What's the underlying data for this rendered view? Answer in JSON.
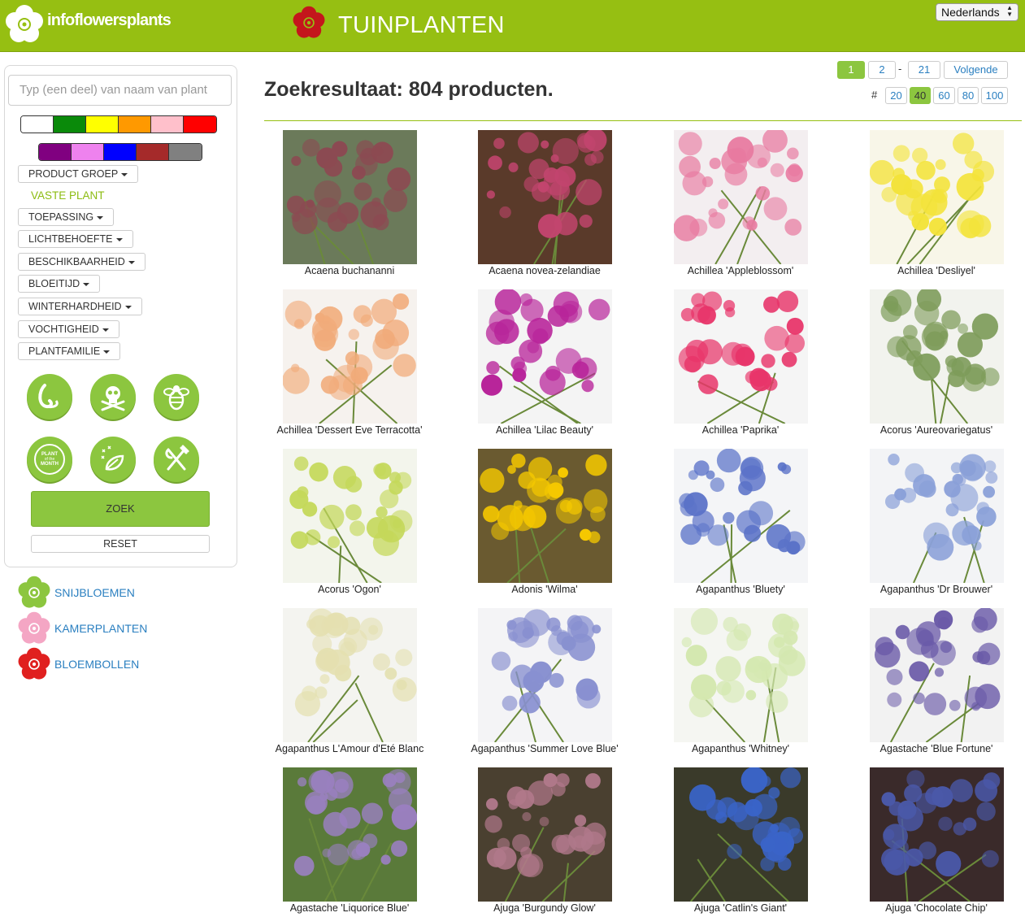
{
  "header": {
    "logo_text": "infoflowersplants",
    "section_title": "TUINPLANTEN",
    "language": "Nederlands"
  },
  "sidebar": {
    "search_placeholder": "Typ (een deel) van naam van plant",
    "color_swatches_row1": [
      "#ffffff",
      "#0a8a0a",
      "#ffff00",
      "#ff9900",
      "#ffc0cb",
      "#ff0000"
    ],
    "color_swatches_row2": [
      "#800080",
      "#ee82ee",
      "#0000ff",
      "#a52a2a",
      "#808080"
    ],
    "filters": [
      {
        "label": "PRODUCT GROEP"
      },
      {
        "label": "TOEPASSING"
      },
      {
        "label": "LICHTBEHOEFTE"
      },
      {
        "label": "BESCHIKBAARHEID"
      },
      {
        "label": "BLOEITIJD"
      },
      {
        "label": "WINTERHARDHEID"
      },
      {
        "label": "VOCHTIGHEID"
      },
      {
        "label": "PLANTFAMILIE"
      }
    ],
    "active_filter": "VASTE PLANT",
    "property_icons": [
      "hook-icon",
      "poison-skull-icon",
      "bee-icon",
      "plant-of-the-month-icon",
      "fragrance-leaf-icon",
      "edible-fork-knife-icon"
    ],
    "plant_of_month_text": [
      "PLANT",
      "of the",
      "MONTH"
    ],
    "zoek_label": "ZOEK",
    "reset_label": "RESET"
  },
  "categories": [
    {
      "label": "SNIJBLOEMEN",
      "color": "#8cc63f"
    },
    {
      "label": "KAMERPLANTEN",
      "color": "#f4a6c4"
    },
    {
      "label": "BLOEMBOLLEN",
      "color": "#e0201f"
    }
  ],
  "results": {
    "title": "Zoekresultaat: 804 producten.",
    "pagination": [
      "1",
      "2",
      "21",
      "Volgende"
    ],
    "pagination_separator": "-",
    "active_page": "1",
    "per_page_label": "#",
    "per_page_options": [
      "20",
      "40",
      "60",
      "80",
      "100"
    ],
    "active_per_page": "40"
  },
  "products": [
    {
      "name": "Acaena buchananni",
      "colors": [
        "#6b7a5a",
        "#8c4a52"
      ]
    },
    {
      "name": "Acaena novea-zelandiae",
      "colors": [
        "#5a3a2a",
        "#c2456e"
      ]
    },
    {
      "name": "Achillea 'Appleblossom'",
      "colors": [
        "#f3eef0",
        "#e87aa0"
      ]
    },
    {
      "name": "Achillea 'Desliyel'",
      "colors": [
        "#f8f6e8",
        "#f3e33a"
      ]
    },
    {
      "name": "Achillea 'Dessert Eve Terracotta'",
      "colors": [
        "#f6f2ee",
        "#f1ab7a"
      ]
    },
    {
      "name": "Achillea 'Lilac Beauty'",
      "colors": [
        "#f4f4f4",
        "#b8249a"
      ]
    },
    {
      "name": "Achillea 'Paprika'",
      "colors": [
        "#f5f5f5",
        "#e8356a"
      ]
    },
    {
      "name": "Acorus 'Aureovariegatus'",
      "colors": [
        "#f2f3ee",
        "#7e9c5a"
      ]
    },
    {
      "name": "Acorus 'Ogon'",
      "colors": [
        "#f3f5ec",
        "#c4d85a"
      ]
    },
    {
      "name": "Adonis 'Wilma'",
      "colors": [
        "#6a5a30",
        "#f5c800"
      ]
    },
    {
      "name": "Agapanthus 'Bluety'",
      "colors": [
        "#f4f5f7",
        "#5a72c8"
      ]
    },
    {
      "name": "Agapanthus 'Dr Brouwer'",
      "colors": [
        "#f3f4f6",
        "#8aa0d8"
      ]
    },
    {
      "name": "Agapanthus L'Amour d'Eté Blanc",
      "colors": [
        "#f4f4f0",
        "#e4e0b0"
      ]
    },
    {
      "name": "Agapanthus 'Summer Love Blue'",
      "colors": [
        "#f4f4f6",
        "#8890d0"
      ]
    },
    {
      "name": "Agapanthus 'Whitney'",
      "colors": [
        "#f5f6f2",
        "#d4e8b0"
      ]
    },
    {
      "name": "Agastache 'Blue Fortune'",
      "colors": [
        "#f2f2f2",
        "#6a5aa8"
      ]
    },
    {
      "name": "Agastache 'Liquorice Blue'",
      "colors": [
        "#5a7a3a",
        "#9a80c0"
      ]
    },
    {
      "name": "Ajuga 'Burgundy Glow'",
      "colors": [
        "#4a4030",
        "#b0788a"
      ]
    },
    {
      "name": "Ajuga 'Catlin's Giant'",
      "colors": [
        "#3a3a2a",
        "#3a64c8"
      ]
    },
    {
      "name": "Ajuga 'Chocolate Chip'",
      "colors": [
        "#3a2a2a",
        "#4a58a8"
      ]
    }
  ]
}
